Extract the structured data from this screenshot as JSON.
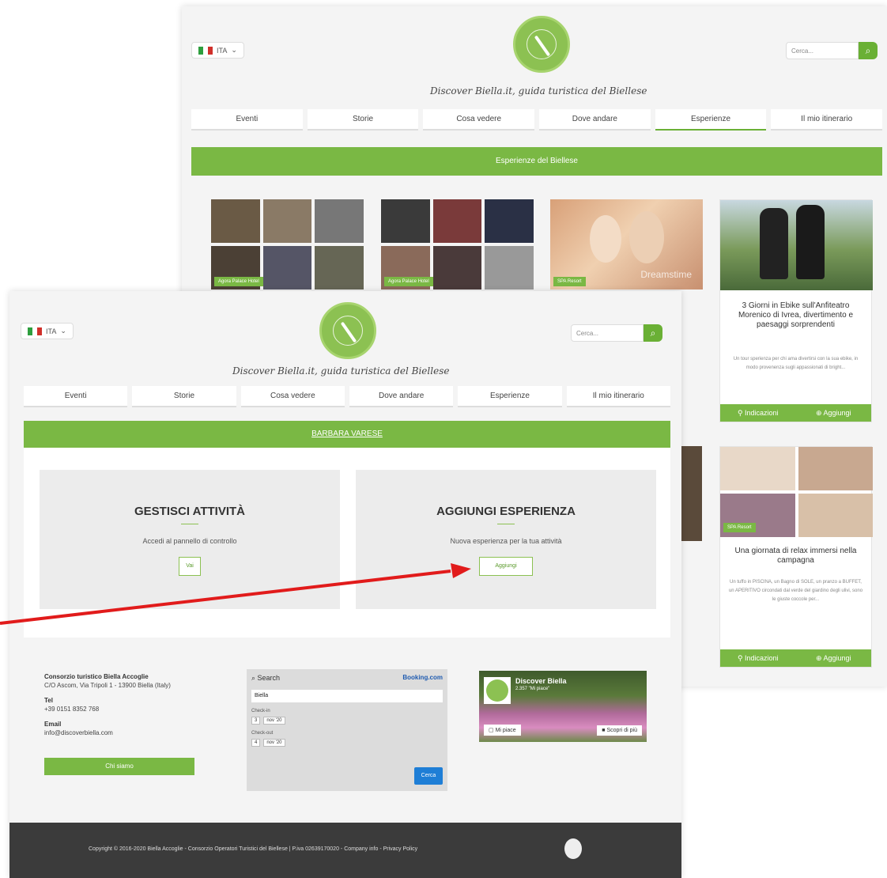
{
  "header": {
    "language": "ITA",
    "tagline": "Discover Biella.it, guida turistica del Biellese",
    "search_placeholder": "Cerca..."
  },
  "nav": [
    "Eventi",
    "Storie",
    "Cosa vedere",
    "Dove andare",
    "Esperienze",
    "Il mio itinerario"
  ],
  "back": {
    "section_title": "Esperienze del Biellese",
    "cards": [
      {
        "badge": "Agora Palace Hotel"
      },
      {
        "badge": "Agora Palace Hotel"
      },
      {
        "badge": "SPA Resort",
        "watermark": "Dreamstime"
      },
      {
        "title": "3 Giorni in Ebike sull'Anfiteatro Morenico di Ivrea, divertimento e paesaggi sorprendenti",
        "desc": "Un tour sperienza per chi ama divertirsi con la sua ebike, in modo provenenza sugli appassionati di bright..."
      }
    ],
    "second_card": {
      "badge": "SPA Resort",
      "title": "Una giornata di relax immersi nella campagna",
      "desc": "Un tuffo in PISCINA, un Bagno di SOLE, un pranzo a BUFFET, un APERITIVO circondati dal verde del giardino degli ulivi, sono le giuste coccole per..."
    },
    "actions": {
      "directions": "Indicazioni",
      "add": "Aggiungi"
    }
  },
  "front": {
    "section_title": "BARBARA VARESE",
    "panels": [
      {
        "title": "GESTISCI ATTIVITÀ",
        "subtitle": "Accedi al pannello di controllo",
        "button": "Vai"
      },
      {
        "title": "AGGIUNGI ESPERIENZA",
        "subtitle": "Nuova esperienza per la tua attività",
        "button": "Aggiungi"
      }
    ],
    "footer": {
      "org_name": "Consorzio turistico Biella Accoglie",
      "org_address": "C/O Ascom, Via Tripoli 1 - 13900 Biella (Italy)",
      "tel_label": "Tel",
      "tel": "+39 0151 8352 768",
      "email_label": "Email",
      "email": "info@discoverbiella.com",
      "contact_button": "Chi siamo"
    },
    "booking": {
      "search_label": "Search",
      "brand": "Booking.com",
      "destination": "Biella",
      "checkin_label": "Check-in",
      "checkin_day": "3",
      "checkin_month": "nov '20",
      "checkout_label": "Check-out",
      "checkout_day": "4",
      "checkout_month": "nov '20",
      "search_button": "Cerca"
    },
    "facebook": {
      "page_name": "Discover Biella",
      "likes": "2.357 \"Mi piace\"",
      "like_button": "Mi piace",
      "share_button": "Scopri di più"
    },
    "copyright": "Copyright © 2016-2020 Biella Accoglie - Consorzio Operatori Turistici del Biellese | P.iva 02639170020 - Company info - Privacy Policy"
  },
  "colors": {
    "accent": "#7ab844",
    "arrow": "#e11b1b",
    "footer_bg": "#3b3b3b"
  }
}
